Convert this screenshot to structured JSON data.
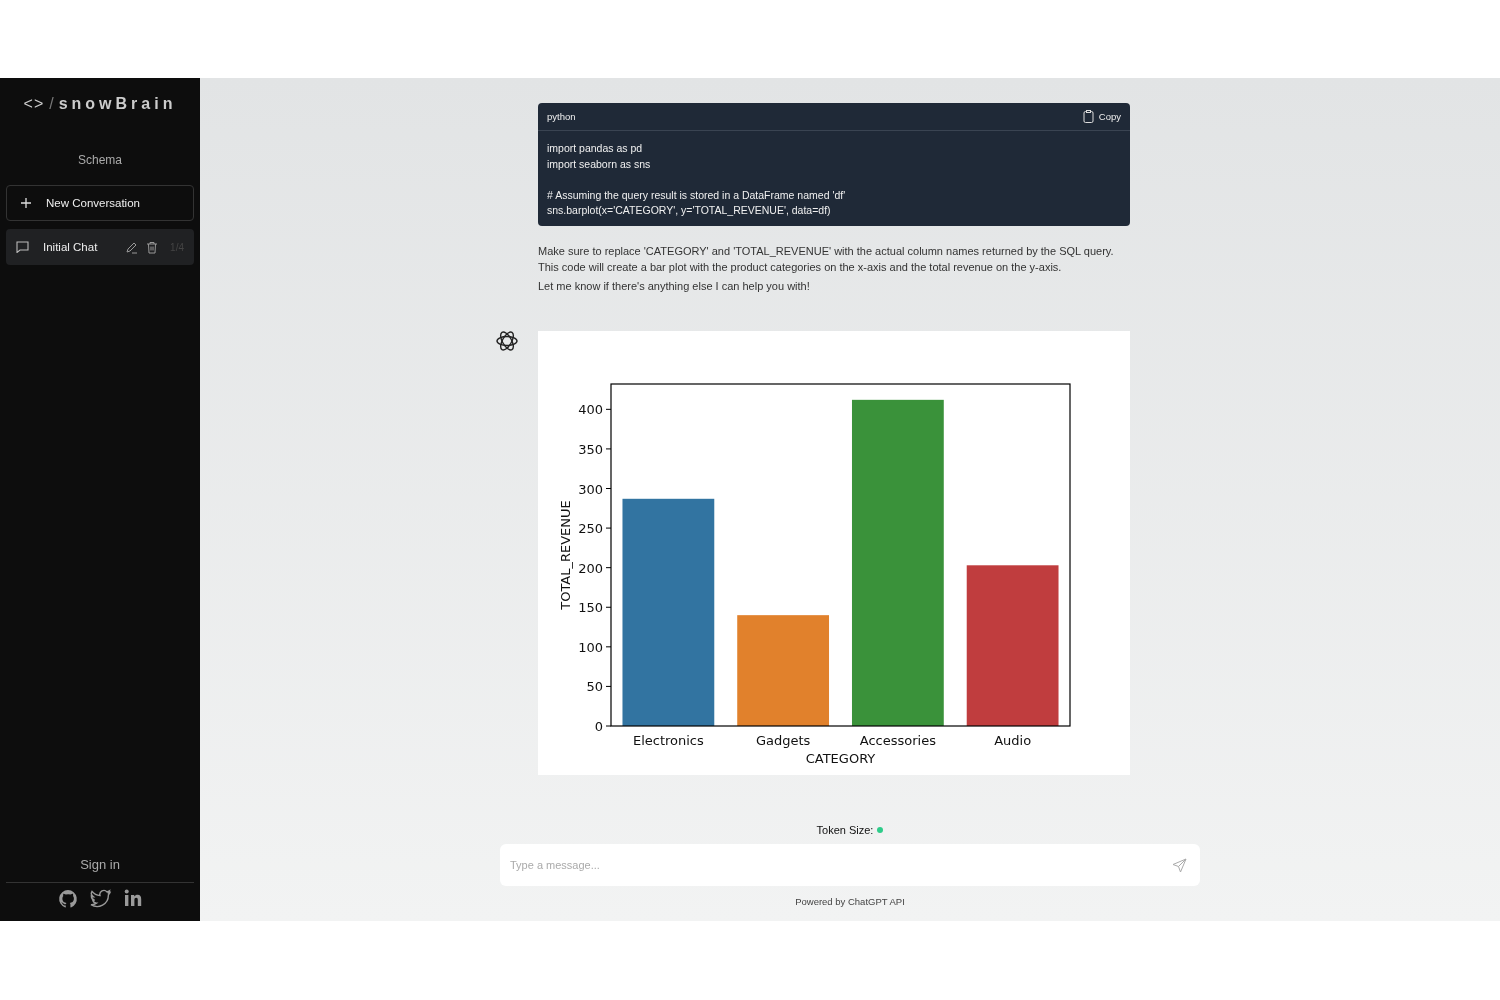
{
  "sidebar": {
    "logo_symbol": "<>",
    "logo_slash": "/",
    "logo_text": "snowBrain",
    "schema_link": "Schema",
    "new_conversation": "New Conversation",
    "conversations": [
      {
        "title": "Initial Chat",
        "count": "1/4",
        "selected": true
      }
    ],
    "sign_in": "Sign in"
  },
  "chat": {
    "code_block": {
      "language": "python",
      "copy_label": "Copy",
      "line_groups": [
        [
          "import pandas as pd",
          "import seaborn as sns"
        ],
        [
          "# Assuming the query result is stored in a DataFrame named 'df'",
          "sns.barplot(x='CATEGORY', y='TOTAL_REVENUE', data=df)"
        ]
      ]
    },
    "paragraphs": [
      "Make sure to replace 'CATEGORY' and 'TOTAL_REVENUE' with the actual column names returned by the SQL query. This code will create a bar plot with the product categories on the x-axis and the total revenue on the y-axis.",
      "Let me know if there's anything else I can help you with!"
    ],
    "chart_data": {
      "type": "bar",
      "xlabel": "CATEGORY",
      "ylabel": "TOTAL_REVENUE",
      "categories": [
        "Electronics",
        "Gadgets",
        "Accessories",
        "Audio"
      ],
      "values": [
        287,
        140,
        412,
        203
      ],
      "ylim": [
        0,
        432
      ],
      "yticks": [
        0,
        50,
        100,
        150,
        200,
        250,
        300,
        350,
        400
      ]
    }
  },
  "footer": {
    "token_label": "Token Size:",
    "input": {
      "placeholder": "Type a message..."
    },
    "powered_by": "Powered by ChatGPT API"
  }
}
